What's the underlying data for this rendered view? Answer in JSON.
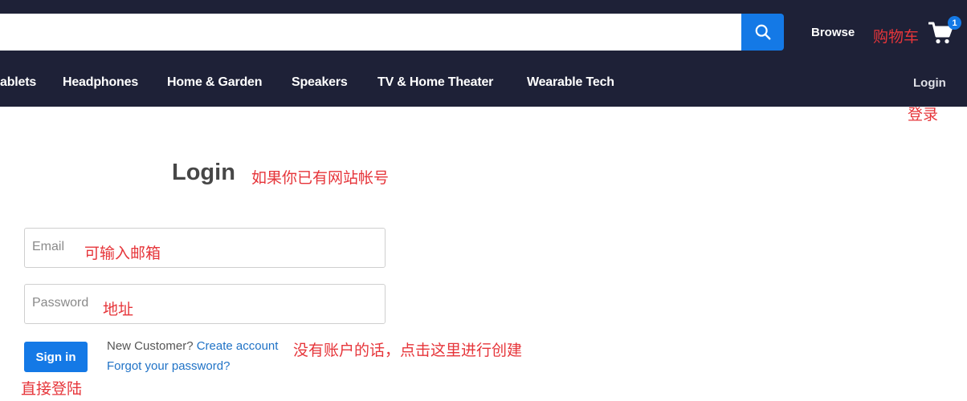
{
  "header": {
    "search": {
      "value": "",
      "placeholder": ""
    },
    "browse_label": "Browse",
    "cart_note": "购物车",
    "cart_count": "1"
  },
  "nav": {
    "items": [
      {
        "label": "ablets"
      },
      {
        "label": "Headphones"
      },
      {
        "label": "Home & Garden"
      },
      {
        "label": "Speakers"
      },
      {
        "label": "TV & Home Theater"
      },
      {
        "label": "Wearable Tech"
      }
    ],
    "login_label": "Login",
    "login_note": "登录"
  },
  "login": {
    "title": "Login",
    "title_note": "如果你已有网站帐号",
    "email": {
      "placeholder": "Email",
      "note": "可输入邮箱"
    },
    "password": {
      "placeholder": "Password",
      "note": "地址"
    },
    "signin_label": "Sign in",
    "signin_note": "直接登陆",
    "new_customer_text": "New Customer?",
    "create_account_label": "Create account",
    "create_note": "没有账户的话，点击这里进行创建",
    "forgot_label": "Forgot your password?"
  },
  "colors": {
    "header_bg": "#1e2137",
    "accent": "#1479e6",
    "annotation": "#e6353a",
    "link": "#1f72c6"
  },
  "icons": {
    "search": "search-icon",
    "cart": "cart-icon"
  }
}
